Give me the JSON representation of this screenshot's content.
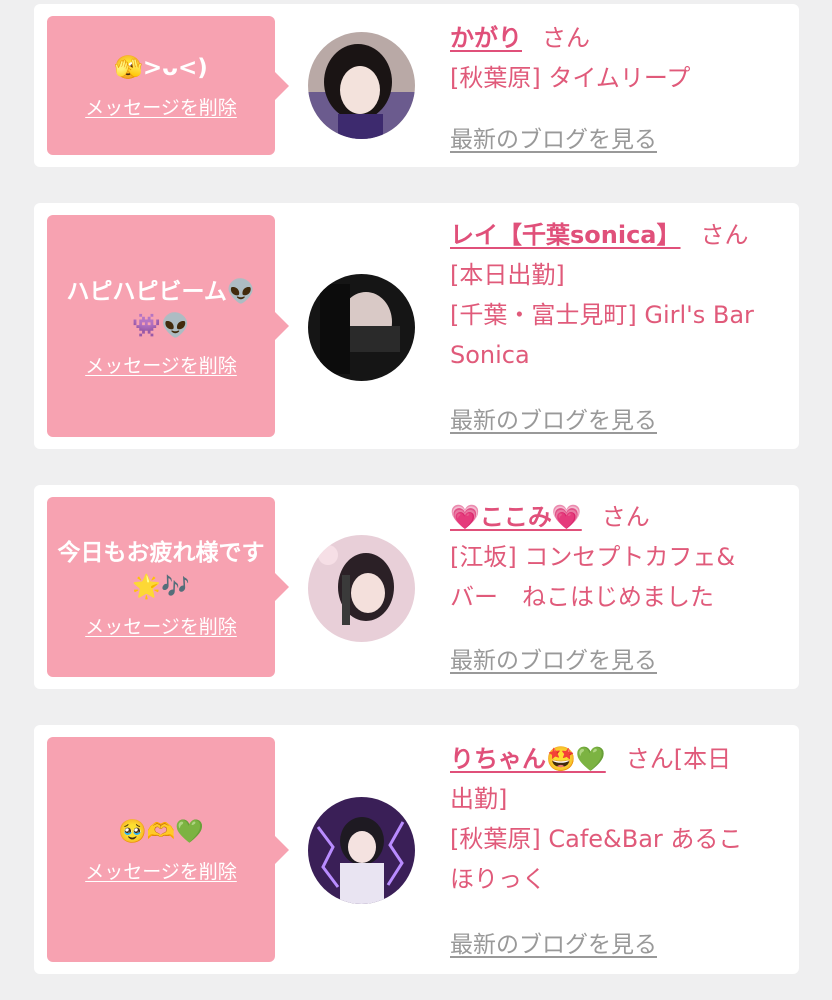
{
  "entries": [
    {
      "message": "🫣>ᴗ<)",
      "delete_label": "メッセージを削除",
      "name": "かがり",
      "honorific": "さん",
      "details": [
        "[秋葉原] タイムリープ"
      ],
      "blog_label": "最新のブログを見る"
    },
    {
      "message": "ハピハピビーム👽👾👽",
      "delete_label": "メッセージを削除",
      "name": "レイ【千葉sonica】",
      "honorific": "さん",
      "details": [
        "[本日出勤]",
        "[千葉・富士見町] Girl's Bar",
        "Sonica"
      ],
      "blog_label": "最新のブログを見る"
    },
    {
      "message": "今日もお疲れ様です🌟🎶",
      "delete_label": "メッセージを削除",
      "name": "💗ここみ💗",
      "honorific": "さん",
      "details": [
        "[江坂] コンセプトカフェ&",
        "バー　ねこはじめました"
      ],
      "blog_label": "最新のブログを見る"
    },
    {
      "message": "🥹🫶💚",
      "delete_label": "メッセージを削除",
      "name": "りちゃん🤩💚",
      "honorific": "さん[本日",
      "details": [
        "出勤]",
        "[秋葉原] Cafe&Bar あるこ",
        "ほりっく"
      ],
      "blog_label": "最新のブログを見る"
    }
  ],
  "colors": {
    "background": "#efeff0",
    "bubble": "#f7a2b1",
    "accent_text": "#e05a7a",
    "link_grey": "#999999"
  }
}
